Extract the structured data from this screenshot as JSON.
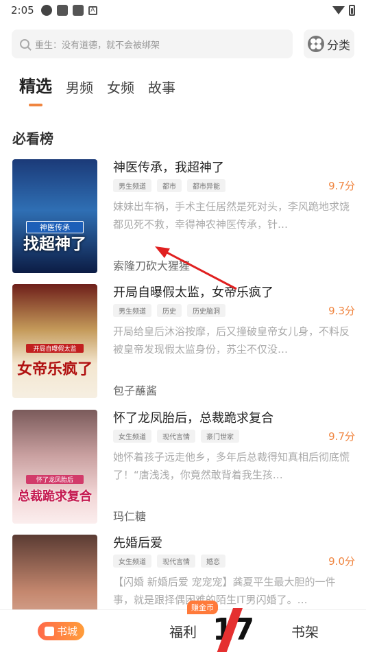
{
  "status": {
    "time": "2:05"
  },
  "search": {
    "placeholder": "重生：没有道德，就不会被绑架"
  },
  "category_label": "分类",
  "tabs": [
    "精选",
    "男频",
    "女频",
    "故事"
  ],
  "section_title": "必看榜",
  "books": [
    {
      "title": "神医传承，我超神了",
      "tags": [
        "男生频道",
        "都市",
        "都市异能"
      ],
      "score": "9.7分",
      "desc": "妹妹出车祸，手术主任居然是死对头，李风跪地求饶都见死不救，幸得神农神医传承，针…",
      "author": "索隆刀砍大猩猩",
      "cover_text": "找超神了",
      "cover_banner": "神医传承"
    },
    {
      "title": "开局自曝假太监，女帝乐疯了",
      "tags": [
        "男生频道",
        "历史",
        "历史脑洞"
      ],
      "score": "9.3分",
      "desc": "开局给皇后沐浴按摩，后又撞破皇帝女儿身，不料反被皇帝发现假太监身份，苏尘不仅没…",
      "author": "包子蘸酱",
      "cover_text": "女帝乐疯了",
      "cover_banner": "开局自曝假太监"
    },
    {
      "title": "怀了龙凤胎后，总裁跪求复合",
      "tags": [
        "女生频道",
        "现代言情",
        "豪门世家"
      ],
      "score": "9.7分",
      "desc": "她怀着孩子远走他乡，多年后总裁得知真相后彻底慌了！“唐浅浅，你竟然敢背着我生孩…",
      "author": "玛仁糖",
      "cover_text": "总裁跪求复合",
      "cover_banner": "怀了龙凤胎后"
    },
    {
      "title": "先婚后爱",
      "tags": [
        "女生频道",
        "现代言情",
        "婚恋"
      ],
      "score": "9.0分",
      "desc": "【闪婚 新婚后爱 宠宠宠】龚夏平生最大胆的一件事，就是跟择偶困难的陌生IT男闪婚了。…",
      "author": "",
      "cover_text": "",
      "cover_banner": ""
    }
  ],
  "bottom_nav": {
    "bookstore": "书城",
    "welfare": "福利",
    "shelf": "书架",
    "coin_badge": "赚金币"
  },
  "colors": {
    "accent": "#f08540",
    "tab_indicator": "#f08540"
  }
}
